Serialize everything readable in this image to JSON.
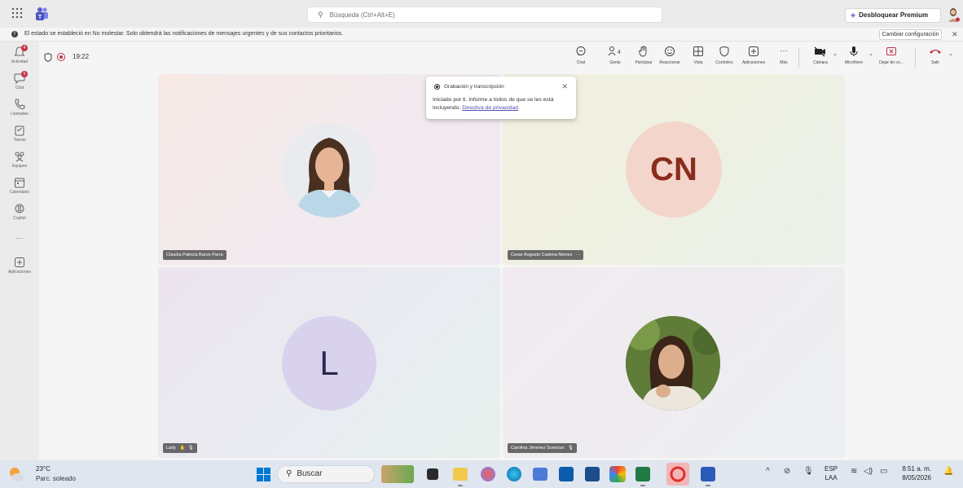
{
  "titlebar": {
    "search_placeholder": "Búsqueda (Ctrl+Alt+E)",
    "premium_label": "Desbloquear Premium",
    "premium_more": "···"
  },
  "notification": {
    "message": "El estado se estableció en No molestar. Solo obtendrá las notificaciones de mensajes urgentes y de sus contactos prioritarios.",
    "config_button": "Cambiar configuración",
    "close": "✕"
  },
  "rail": [
    {
      "label": "Actividad",
      "badge": "4"
    },
    {
      "label": "Chat",
      "badge": "5"
    },
    {
      "label": "Llamadas"
    },
    {
      "label": "Tareas"
    },
    {
      "label": "Equipos"
    },
    {
      "label": "Calendario"
    },
    {
      "label": "Copilot"
    },
    {
      "label": "···"
    },
    {
      "label": "Aplicaciones"
    }
  ],
  "meeting": {
    "timer": "19:22",
    "tools": [
      {
        "label": "Chat"
      },
      {
        "label": "Gente",
        "count": "4"
      },
      {
        "label": "Participar"
      },
      {
        "label": "Reaccionar"
      },
      {
        "label": "Vista"
      },
      {
        "label": "Controles"
      },
      {
        "label": "Aplicaciones"
      },
      {
        "label": "Más"
      }
    ],
    "camera_label": "Cámara",
    "mic_label": "Micrófono",
    "share_label": "Dejar de co...",
    "leave_label": "Salir"
  },
  "popup": {
    "title": "Grabación y transcripción",
    "text": "Iniciado por ti. Informe a todos de que se les está incluyendo.",
    "link": "Directiva de privacidad"
  },
  "participants": [
    {
      "name": "Claudia Patricia Baron Parra",
      "type": "photo"
    },
    {
      "name": "Cesar Augusto Cadena Nieves",
      "type": "initials",
      "initials": "CN",
      "extra": "···"
    },
    {
      "name": "Lady",
      "type": "initials",
      "initials": "L"
    },
    {
      "name": "Carolina Jimenez Suescun",
      "type": "photo"
    }
  ],
  "taskbar": {
    "temp": "23°C",
    "weather": "Parc. soleado",
    "search": "Buscar",
    "lang_top": "ESP",
    "lang_bottom": "LAA",
    "time": "8:51 a. m.",
    "date": "8/05/2026"
  },
  "colors": {
    "teams_purple": "#5b5fc7",
    "leave_red": "#c4314b",
    "cn_circle": "#f3d5cc",
    "cn_text": "#8a2c1c",
    "l_circle": "#d8d2ec",
    "l_text": "#2a2750"
  }
}
